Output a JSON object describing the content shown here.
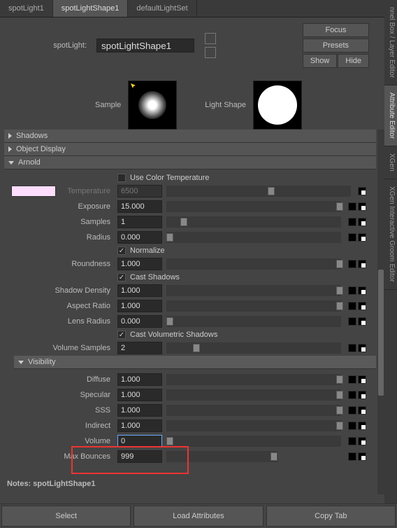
{
  "tabs": {
    "t0": "spotLight1",
    "t1": "spotLightShape1",
    "t2": "defaultLightSet"
  },
  "header": {
    "label": "spotLight:",
    "value": "spotLightShape1",
    "focus": "Focus",
    "presets": "Presets",
    "show": "Show",
    "hide": "Hide"
  },
  "previews": {
    "sample": "Sample",
    "shape": "Light Shape"
  },
  "sections": {
    "shadows": "Shadows",
    "objdisplay": "Object Display",
    "arnold": "Arnold",
    "visibility": "Visibility"
  },
  "attrs": {
    "usecolortemp_label": "Use Color Temperature",
    "temperature_label": "Temperature",
    "temperature": "6500",
    "exposure_label": "Exposure",
    "exposure": "15.000",
    "samples_label": "Samples",
    "samples": "1",
    "radius_label": "Radius",
    "radius": "0.000",
    "normalize_label": "Normalize",
    "roundness_label": "Roundness",
    "roundness": "1.000",
    "castshadows_label": "Cast Shadows",
    "shadowdensity_label": "Shadow Density",
    "shadowdensity": "1.000",
    "aspect_label": "Aspect Ratio",
    "aspect": "1.000",
    "lensradius_label": "Lens Radius",
    "lensradius": "0.000",
    "castvol_label": "Cast Volumetric Shadows",
    "volsamples_label": "Volume Samples",
    "volsamples": "2",
    "diffuse_label": "Diffuse",
    "diffuse": "1.000",
    "specular_label": "Specular",
    "specular": "1.000",
    "sss_label": "SSS",
    "sss": "1.000",
    "indirect_label": "Indirect",
    "indirect": "1.000",
    "volume_label": "Volume",
    "volume": "0",
    "maxbounces_label": "Max Bounces",
    "maxbounces": "999"
  },
  "notes": "Notes: spotLightShape1",
  "footer": {
    "select": "Select",
    "load": "Load Attributes",
    "copy": "Copy Tab"
  },
  "side": {
    "cb": "nnel Box / Layer Editor",
    "ae": "Attribute Editor",
    "xgen": "XGen",
    "xig": "XGen Interactive Groom Editor"
  }
}
